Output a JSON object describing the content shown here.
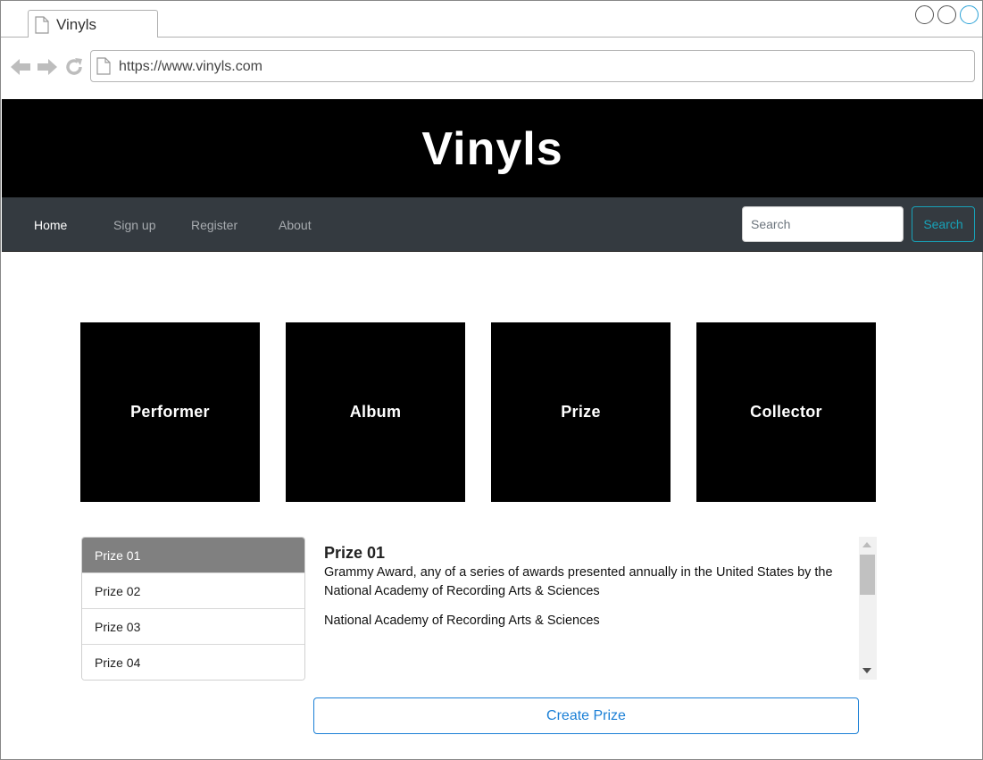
{
  "browser": {
    "tab_title": "Vinyls",
    "url": "https://www.vinyls.com"
  },
  "header": {
    "title": "Vinyls"
  },
  "navbar": {
    "links": [
      "Home",
      "Sign up",
      "Register",
      "About"
    ],
    "active": "Home",
    "search_placeholder": "Search",
    "search_button": "Search"
  },
  "categories": [
    "Performer",
    "Album",
    "Prize",
    "Collector"
  ],
  "prizes": {
    "items": [
      "Prize 01",
      "Prize 02",
      "Prize 03",
      "Prize 04"
    ],
    "selected": "Prize 01"
  },
  "detail": {
    "title": "Prize 01",
    "description": "Grammy Award, any of a series of awards presented annually in the United States by the National Academy of Recording Arts & Sciences",
    "organization": "National Academy of Recording Arts & Sciences"
  },
  "actions": {
    "create_prize": "Create Prize"
  },
  "colors": {
    "header_bg": "#000000",
    "navbar_bg": "#343a40",
    "search_accent": "#17a2b8",
    "primary_accent": "#1a7fd6",
    "list_active_bg": "#808080"
  }
}
